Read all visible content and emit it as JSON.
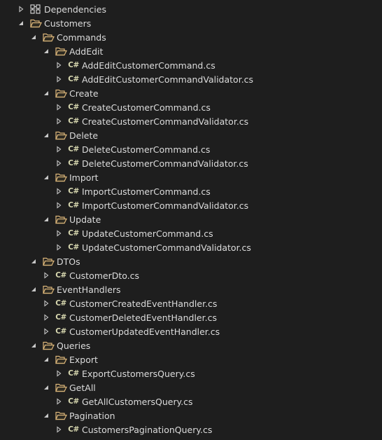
{
  "tree": {
    "nodes": [
      {
        "label": "Dependencies",
        "depth": 0,
        "type": "deps",
        "expanded": false
      },
      {
        "label": "Customers",
        "depth": 0,
        "type": "folder",
        "expanded": true
      },
      {
        "label": "Commands",
        "depth": 1,
        "type": "folder",
        "expanded": true
      },
      {
        "label": "AddEdit",
        "depth": 2,
        "type": "folder",
        "expanded": true
      },
      {
        "label": "AddEditCustomerCommand.cs",
        "depth": 3,
        "type": "cs",
        "expanded": false
      },
      {
        "label": "AddEditCustomerCommandValidator.cs",
        "depth": 3,
        "type": "cs",
        "expanded": false
      },
      {
        "label": "Create",
        "depth": 2,
        "type": "folder",
        "expanded": true
      },
      {
        "label": "CreateCustomerCommand.cs",
        "depth": 3,
        "type": "cs",
        "expanded": false
      },
      {
        "label": "CreateCustomerCommandValidator.cs",
        "depth": 3,
        "type": "cs",
        "expanded": false
      },
      {
        "label": "Delete",
        "depth": 2,
        "type": "folder",
        "expanded": true
      },
      {
        "label": "DeleteCustomerCommand.cs",
        "depth": 3,
        "type": "cs",
        "expanded": false
      },
      {
        "label": "DeleteCustomerCommandValidator.cs",
        "depth": 3,
        "type": "cs",
        "expanded": false
      },
      {
        "label": "Import",
        "depth": 2,
        "type": "folder",
        "expanded": true
      },
      {
        "label": "ImportCustomerCommand.cs",
        "depth": 3,
        "type": "cs",
        "expanded": false
      },
      {
        "label": "ImportCustomerCommandValidator.cs",
        "depth": 3,
        "type": "cs",
        "expanded": false
      },
      {
        "label": "Update",
        "depth": 2,
        "type": "folder",
        "expanded": true
      },
      {
        "label": "UpdateCustomerCommand.cs",
        "depth": 3,
        "type": "cs",
        "expanded": false
      },
      {
        "label": "UpdateCustomerCommandValidator.cs",
        "depth": 3,
        "type": "cs",
        "expanded": false
      },
      {
        "label": "DTOs",
        "depth": 1,
        "type": "folder",
        "expanded": true
      },
      {
        "label": "CustomerDto.cs",
        "depth": 2,
        "type": "cs",
        "expanded": false
      },
      {
        "label": "EventHandlers",
        "depth": 1,
        "type": "folder",
        "expanded": true
      },
      {
        "label": "CustomerCreatedEventHandler.cs",
        "depth": 2,
        "type": "cs",
        "expanded": false
      },
      {
        "label": "CustomerDeletedEventHandler.cs",
        "depth": 2,
        "type": "cs",
        "expanded": false
      },
      {
        "label": "CustomerUpdatedEventHandler.cs",
        "depth": 2,
        "type": "cs",
        "expanded": false
      },
      {
        "label": "Queries",
        "depth": 1,
        "type": "folder",
        "expanded": true
      },
      {
        "label": "Export",
        "depth": 2,
        "type": "folder",
        "expanded": true
      },
      {
        "label": "ExportCustomersQuery.cs",
        "depth": 3,
        "type": "cs",
        "expanded": false
      },
      {
        "label": "GetAll",
        "depth": 2,
        "type": "folder",
        "expanded": true
      },
      {
        "label": "GetAllCustomersQuery.cs",
        "depth": 3,
        "type": "cs",
        "expanded": false
      },
      {
        "label": "Pagination",
        "depth": 2,
        "type": "folder",
        "expanded": true
      },
      {
        "label": "CustomersPaginationQuery.cs",
        "depth": 3,
        "type": "cs",
        "expanded": false
      }
    ]
  },
  "icons": {
    "folder": "folder-open-icon",
    "cs": "csharp-file-icon",
    "deps": "dependencies-icon",
    "expanded": "expanded-arrow-icon",
    "collapsed": "collapsed-arrow-icon"
  },
  "colors": {
    "background": "#1e1e1e",
    "text": "#dcdcdc",
    "arrow": "#c8c8c8",
    "folder": "#dcb67a",
    "cs_glyph": "#d8d8b0"
  },
  "cs_glyph": "C#"
}
